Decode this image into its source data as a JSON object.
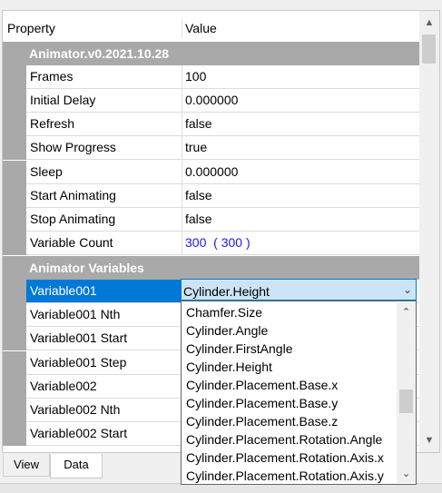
{
  "header": {
    "property": "Property",
    "value": "Value"
  },
  "groups": [
    {
      "name": "Animator.v0.2021.10.28"
    },
    {
      "name": "Animator Variables"
    }
  ],
  "animator_props": [
    {
      "name": "Frames",
      "value": "100"
    },
    {
      "name": "Initial Delay",
      "value": "0.000000"
    },
    {
      "name": "Refresh",
      "value": "false"
    },
    {
      "name": "Show Progress",
      "value": "true"
    },
    {
      "name": "Sleep",
      "value": "0.000000"
    },
    {
      "name": "Start Animating",
      "value": "false"
    },
    {
      "name": "Stop Animating",
      "value": "false"
    },
    {
      "name": "Variable Count",
      "value": "300  ( 300 )"
    }
  ],
  "variable_props": [
    {
      "name": "Variable001",
      "value": "Cylinder.Height"
    },
    {
      "name": "Variable001 Nth",
      "value": ""
    },
    {
      "name": "Variable001 Start",
      "value": ""
    },
    {
      "name": "Variable001 Step",
      "value": ""
    },
    {
      "name": "Variable002",
      "value": ""
    },
    {
      "name": "Variable002 Nth",
      "value": ""
    },
    {
      "name": "Variable002 Start",
      "value": ""
    }
  ],
  "dropdown": {
    "options": [
      "Chamfer.Size",
      "Cylinder.Angle",
      "Cylinder.FirstAngle",
      "Cylinder.Height",
      "Cylinder.Placement.Base.x",
      "Cylinder.Placement.Base.y",
      "Cylinder.Placement.Base.z",
      "Cylinder.Placement.Rotation.Angle",
      "Cylinder.Placement.Rotation.Axis.x",
      "Cylinder.Placement.Rotation.Axis.y"
    ]
  },
  "tabs": [
    "View",
    "Data"
  ],
  "active_tab": "Data",
  "icons": {
    "scroll_up": "chevron-up-icon",
    "scroll_down": "chevron-down-icon",
    "combo_arrow": "chevron-down-icon"
  },
  "colors": {
    "group_bg": "#a9a9a9",
    "selection": "#0078d7",
    "combo_bg": "#cce4f7",
    "count_text": "#1a1ae6"
  }
}
